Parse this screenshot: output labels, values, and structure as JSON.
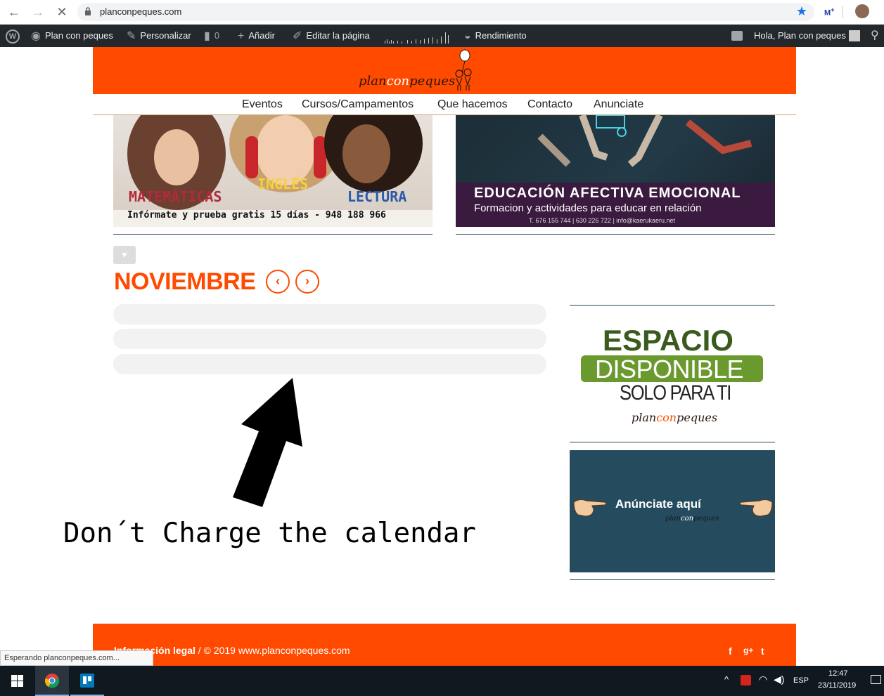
{
  "browser": {
    "url": "planconpeques.com",
    "back": "←",
    "forward": "→",
    "stop": "✕",
    "bookmark": "★"
  },
  "adminbar": {
    "site_name": "Plan con peques",
    "customize": "Personalizar",
    "comments_count": "0",
    "add_new": "Añadir",
    "edit_page": "Editar la página",
    "performance": "Rendimiento",
    "greeting": "Hola, Plan con peques"
  },
  "header": {
    "logo_plan": "plan",
    "logo_con": "con",
    "logo_peques": "peques"
  },
  "nav": {
    "items": [
      "Eventos",
      "Cursos/Campamentos",
      "Que hacemos",
      "Contacto",
      "Anunciate"
    ]
  },
  "banner_left": {
    "word_math": "MATEMÁTICAS",
    "word_english": "INGLÉS",
    "word_reading": "LECTURA",
    "tagline": "Infórmate y prueba gratis 15 días - 948 188 966"
  },
  "banner_right": {
    "title": "EDUCACIÓN AFECTIVA EMOCIONAL",
    "subtitle": "Formacion y actividades para educar en relación",
    "contact": "T. 676 155 744 | 630 226 722 | info@kaerukaeru.net"
  },
  "calendar": {
    "month": "NOVIEMBRE",
    "prev": "‹",
    "next": "›"
  },
  "annotation": "Don´t Charge the calendar",
  "ad_espacio": {
    "line1": "ESPACIO",
    "line2": "DISPONIBLE",
    "line3": "SOLO PARA TI",
    "brand_plan": "plan",
    "brand_con": "con",
    "brand_peques": "peques"
  },
  "ad_anunciate": {
    "text": "Anúnciate aquí",
    "brand_plan": "plan",
    "brand_con": "con",
    "brand_peques": "peques"
  },
  "footer": {
    "legal": "Información legal",
    "copyright": " / © 2019 www.planconpeques.com",
    "social": [
      "f",
      "g+",
      "t"
    ]
  },
  "status_tip": "Esperando planconpeques.com...",
  "taskbar": {
    "time": "12:47",
    "date": "23/11/2019",
    "lang": "ESP"
  },
  "colors": {
    "brand_orange": "#ff4a00",
    "admin_bar": "#23282d",
    "ad_green": "#6a9a2e",
    "ad_teal": "#244b5e",
    "banner_purple": "#3a1a3e"
  }
}
